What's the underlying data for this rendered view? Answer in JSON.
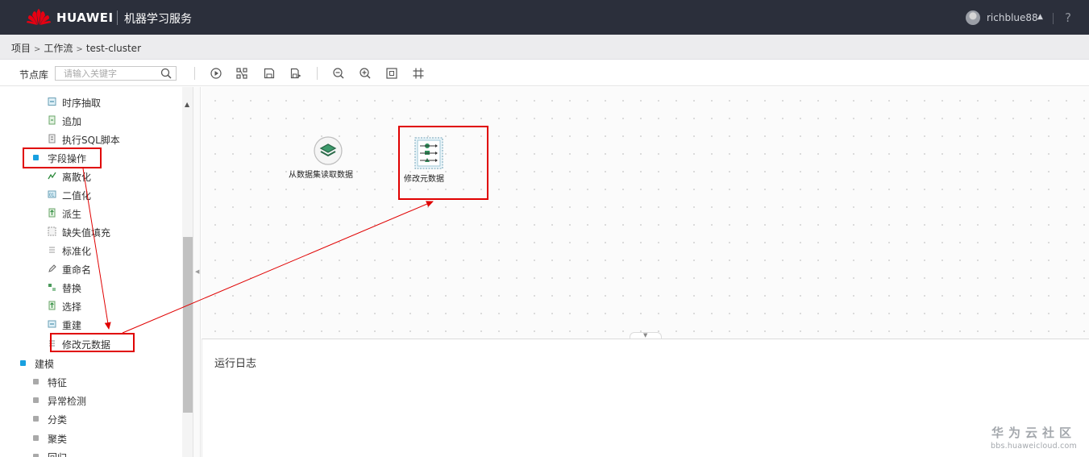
{
  "topbar": {
    "brand": "HUAWEI",
    "product": "机器学习服务",
    "username": "richblue88",
    "help": "?",
    "brand_color": "#2b2f3b"
  },
  "breadcrumb": {
    "items": [
      "项目",
      "工作流",
      "test-cluster"
    ]
  },
  "toolbar": {
    "library_label": "节点库",
    "search_placeholder": "请输入关键字",
    "icons": [
      "run-icon",
      "layout-icon",
      "save-icon",
      "save-as-icon",
      "zoom-out-icon",
      "zoom-in-icon",
      "fit-icon",
      "grid-icon"
    ]
  },
  "sidebar": {
    "items": [
      {
        "label": "时序抽取",
        "level": 2
      },
      {
        "label": "追加",
        "level": 2
      },
      {
        "label": "执行SQL脚本",
        "level": 2
      },
      {
        "label": "字段操作",
        "level": 1,
        "expanded": true
      },
      {
        "label": "离散化",
        "level": 2
      },
      {
        "label": "二值化",
        "level": 2
      },
      {
        "label": "派生",
        "level": 2
      },
      {
        "label": "缺失值填充",
        "level": 2
      },
      {
        "label": "标准化",
        "level": 2
      },
      {
        "label": "重命名",
        "level": 2
      },
      {
        "label": "替换",
        "level": 2
      },
      {
        "label": "选择",
        "level": 2
      },
      {
        "label": "重建",
        "level": 2
      },
      {
        "label": "修改元数据",
        "level": 2
      },
      {
        "label": "建模",
        "level": 0,
        "expanded": true
      },
      {
        "label": "特征",
        "level": 1
      },
      {
        "label": "异常检测",
        "level": 1
      },
      {
        "label": "分类",
        "level": 1
      },
      {
        "label": "聚类",
        "level": 1
      },
      {
        "label": "回归",
        "level": 1
      }
    ]
  },
  "canvas": {
    "nodes": [
      {
        "label": "从数据集读取数据",
        "icon": "dataset-icon"
      },
      {
        "label": "修改元数据",
        "icon": "metadata-icon"
      }
    ]
  },
  "log": {
    "title": "运行日志"
  },
  "watermark": {
    "main": "华为云社区",
    "sub": "bbs.huaweicloud.com"
  },
  "colors": {
    "annotation": "#e00000",
    "accent": "#18a0e0"
  }
}
